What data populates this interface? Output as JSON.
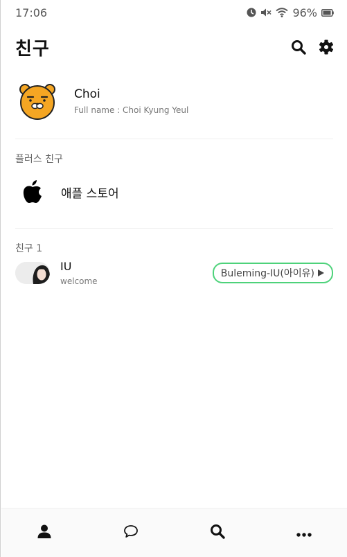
{
  "status_bar": {
    "time": "17:06",
    "battery_percent": "96%",
    "battery_level": 0.96
  },
  "header": {
    "title": "친구"
  },
  "profile": {
    "name": "Choi",
    "full_name": "Full name : Choi Kyung Yeul"
  },
  "plus_friends": {
    "section_title": "플러스 친구",
    "items": [
      {
        "label": "애플 스토어"
      }
    ]
  },
  "friends": {
    "section_title": "친구 1",
    "items": [
      {
        "name": "IU",
        "status_message": "welcome",
        "music": "Buleming-IU(아이유)"
      }
    ]
  },
  "icons": {
    "status": [
      "alarm-icon",
      "mute-icon",
      "wifi-icon",
      "battery-icon"
    ],
    "header": [
      "search-icon",
      "gear-icon"
    ],
    "bottom_nav": [
      "person-icon",
      "chat-bubble-icon",
      "search-icon",
      "more-dots-icon"
    ]
  }
}
